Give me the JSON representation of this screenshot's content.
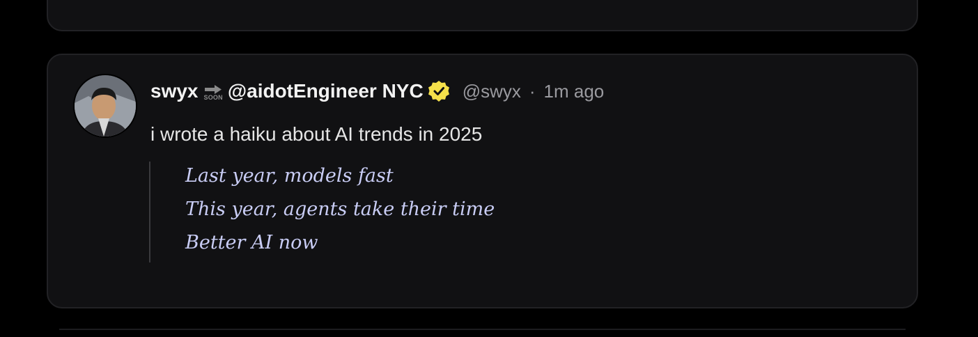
{
  "post": {
    "author_name": "swyx",
    "soon_label": "SOON",
    "author_affiliation": "@aidotEngineer NYC",
    "handle": "@swyx",
    "separator": "·",
    "time": "1m ago",
    "body": "i wrote a haiku about AI trends in 2025",
    "quote_lines": [
      "Last year, models fast",
      "This year, agents take their time",
      "Better AI now"
    ]
  },
  "colors": {
    "background": "#000000",
    "card": "#111113",
    "verified_badge": "#f5e04a",
    "quote_text": "#c9cdf5",
    "muted_text": "#9a9a9f"
  },
  "icons": {
    "soon": "soon-arrow-icon",
    "verified": "verified-badge-icon"
  }
}
